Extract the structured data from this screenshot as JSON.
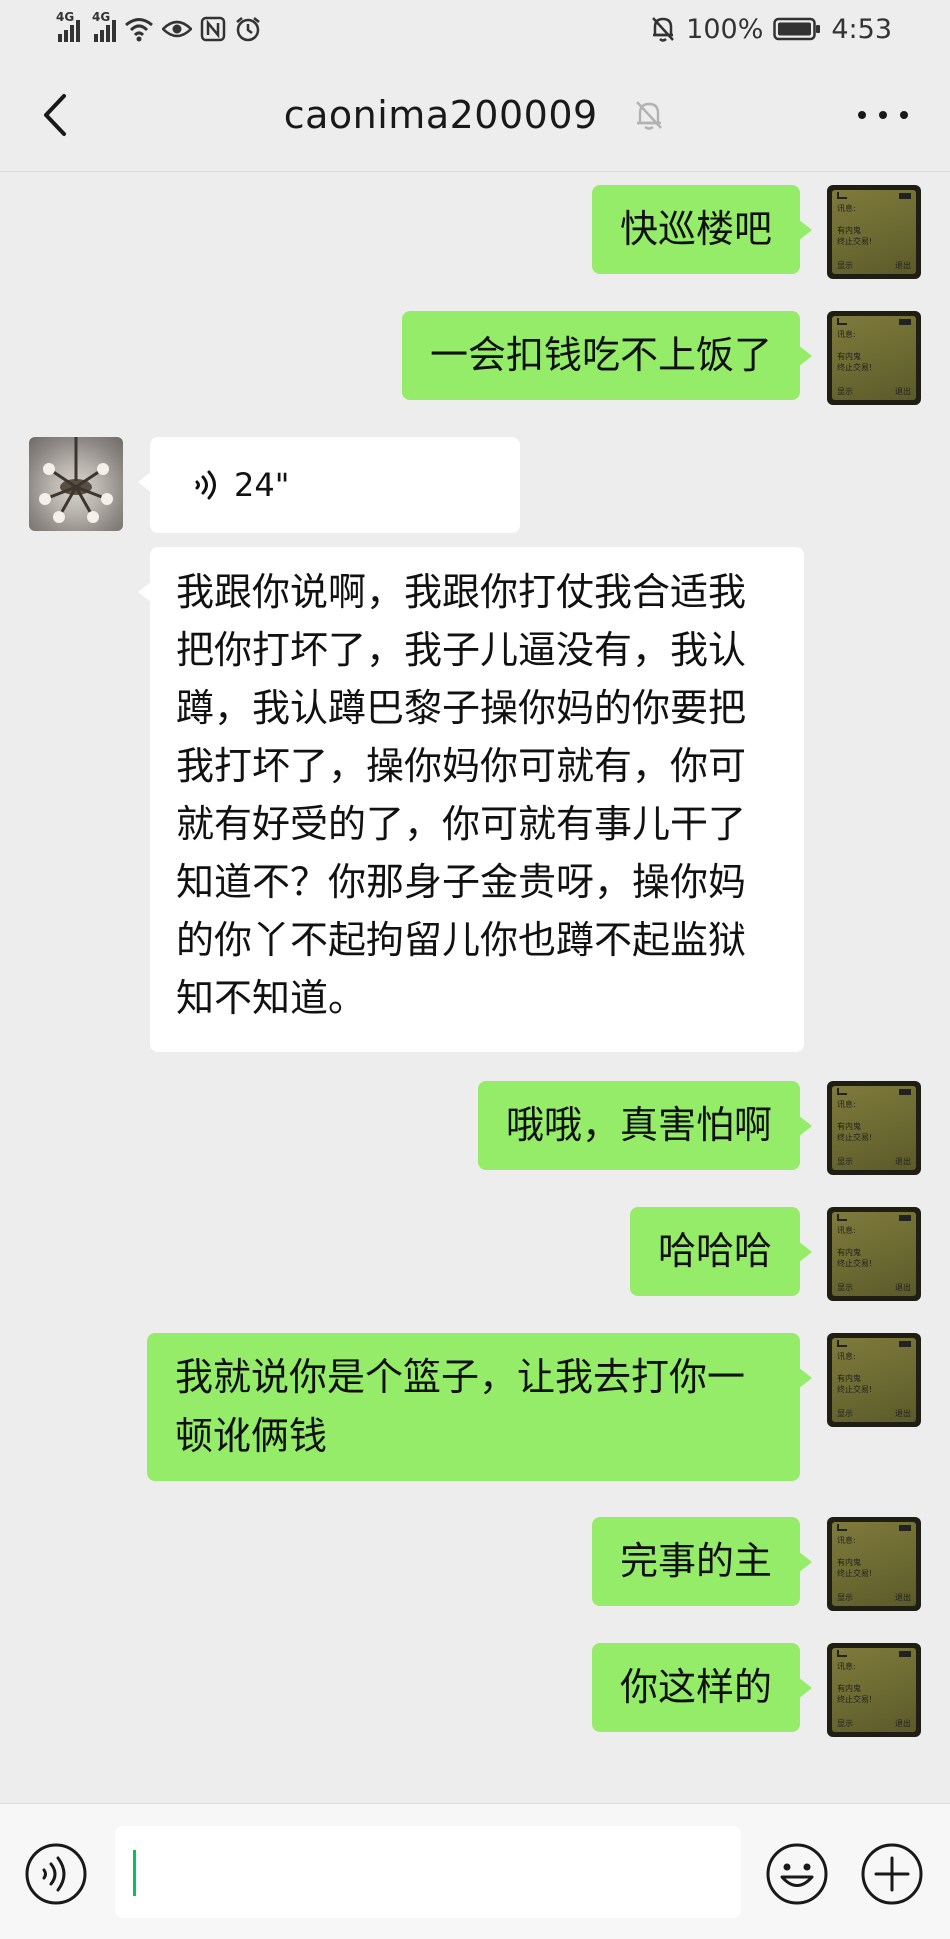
{
  "status_bar": {
    "network_1": "4G",
    "network_2": "4G",
    "battery_percent": "100%",
    "time": "4:53",
    "icons": [
      "signal-icon",
      "signal-icon",
      "wifi-icon",
      "eye-icon",
      "nfc-icon",
      "alarm-icon",
      "mute-bell-icon",
      "battery-icon"
    ]
  },
  "header": {
    "title": "caonima200009",
    "muted": true,
    "icons": [
      "back-chevron-icon",
      "mute-bell-icon",
      "more-dots-icon"
    ]
  },
  "pager_avatar": {
    "line1": "讯息:",
    "line2": "有内鬼",
    "line3": "终止交易!",
    "softkey_left": "显示",
    "softkey_right": "退出"
  },
  "messages": [
    {
      "from": "me",
      "type": "text",
      "text": "快巡楼吧"
    },
    {
      "from": "me",
      "type": "text",
      "text": "一会扣钱吃不上饭了"
    },
    {
      "from": "them",
      "type": "voice",
      "duration": "24\""
    },
    {
      "from": "them",
      "type": "text",
      "lines": [
        "我跟你说啊，我跟你打仗我合适我",
        "把你打坏了，我子儿逼没有，我认",
        "蹲，我认蹲巴黎子操你妈的你要把",
        "我打坏了，操你妈你可就有，你可",
        "就有好受的了，你可就有事儿干了",
        "知道不？你那身子金贵呀，操你妈",
        "的你丫不起拘留儿你也蹲不起监狱",
        "知不知道。"
      ]
    },
    {
      "from": "me",
      "type": "text",
      "text": "哦哦，真害怕啊"
    },
    {
      "from": "me",
      "type": "text",
      "text": "哈哈哈"
    },
    {
      "from": "me",
      "type": "text",
      "lines": [
        "我就说你是个篮子，让我去打你一",
        "顿讹俩钱"
      ]
    },
    {
      "from": "me",
      "type": "text",
      "text": "完事的主"
    },
    {
      "from": "me",
      "type": "text",
      "text": "你这样的"
    },
    {
      "from": "them",
      "type": "voice",
      "duration": ""
    }
  ],
  "input_bar": {
    "value": "",
    "icons": [
      "voice-input-icon",
      "emoji-icon",
      "plus-icon"
    ]
  },
  "colors": {
    "background": "#ededed",
    "my_bubble": "#95ec69",
    "their_bubble": "#ffffff",
    "caret": "#07c160"
  }
}
